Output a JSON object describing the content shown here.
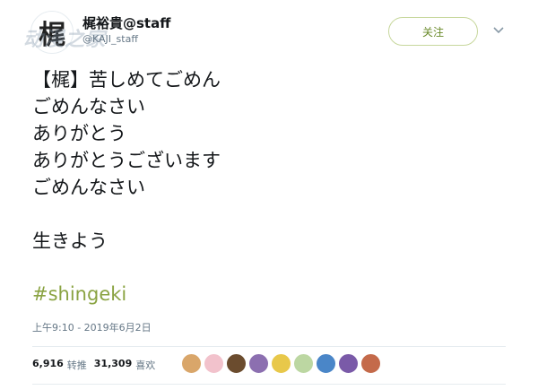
{
  "author": {
    "avatar_glyph": "梶",
    "name": "梶裕貴@staff",
    "handle": "@KAJI_staff"
  },
  "watermark": "动漫之家",
  "follow_button": "关注",
  "tweet": {
    "lines": [
      "【梶】苦しめてごめん",
      "ごめんなさい",
      "ありがとう",
      "ありがとうございます",
      "ごめんなさい",
      "",
      "生きよう"
    ],
    "hashtag": "#shingeki",
    "timestamp": "上午9:10 - 2019年6月2日"
  },
  "stats": {
    "retweets_count": "6,916",
    "retweets_label": "转推",
    "likes_count": "31,309",
    "likes_label": "喜欢"
  },
  "likers": [
    {
      "color": "#d9a66a"
    },
    {
      "color": "#f2c2cc"
    },
    {
      "color": "#6b4c2e"
    },
    {
      "color": "#8c6fb0"
    },
    {
      "color": "#e8c84a"
    },
    {
      "color": "#bcd7a2"
    },
    {
      "color": "#4a86c8"
    },
    {
      "color": "#7a5aa8"
    },
    {
      "color": "#c46a4a"
    }
  ],
  "colors": {
    "accent": "#8aa342",
    "follow_border": "#c7d79c"
  }
}
